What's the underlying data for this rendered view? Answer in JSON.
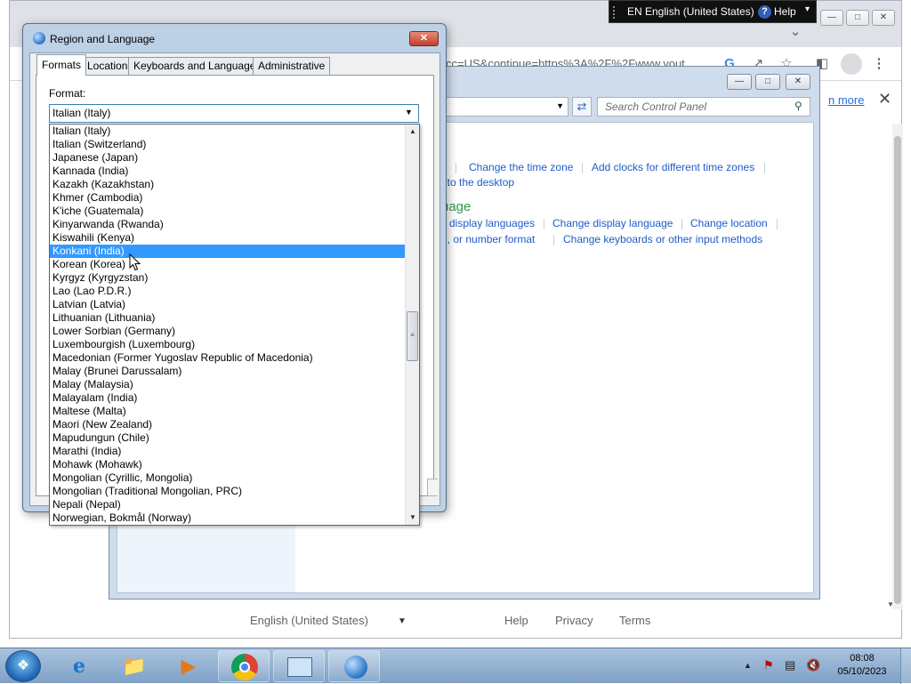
{
  "language_bar": {
    "text": "EN English (United States)",
    "help_label": "Help"
  },
  "chrome": {
    "url_fragment": "cc=US&continue=https%3A%2F%2Fwww.yout",
    "infobar_link": "n more",
    "footer": {
      "language": "English (United States)",
      "links": [
        "Help",
        "Privacy",
        "Terms"
      ]
    }
  },
  "control_panel": {
    "search_placeholder": "Search Control Panel",
    "links_row1": [
      "e",
      "Change the time zone",
      "Add clocks for different time zones"
    ],
    "link_row2": "t to the desktop",
    "heading": "uage",
    "links_row3": [
      "display languages",
      "Change display language",
      "Change location"
    ],
    "links_row4": [
      "e, or number format",
      "Change keyboards or other input methods"
    ]
  },
  "dialog": {
    "title": "Region and Language",
    "tabs": [
      "Formats",
      "Location",
      "Keyboards and Languages",
      "Administrative"
    ],
    "active_tab": "Formats",
    "format_label": "Format:",
    "selected_format": "Italian (Italy)",
    "options": [
      "Italian (Italy)",
      "Italian (Switzerland)",
      "Japanese (Japan)",
      "Kannada (India)",
      "Kazakh (Kazakhstan)",
      "Khmer (Cambodia)",
      "K'iche (Guatemala)",
      "Kinyarwanda (Rwanda)",
      "Kiswahili (Kenya)",
      "Konkani (India)",
      "Korean (Korea)",
      "Kyrgyz (Kyrgyzstan)",
      "Lao (Lao P.D.R.)",
      "Latvian (Latvia)",
      "Lithuanian (Lithuania)",
      "Lower Sorbian (Germany)",
      "Luxembourgish (Luxembourg)",
      "Macedonian (Former Yugoslav Republic of Macedonia)",
      "Malay (Brunei Darussalam)",
      "Malay (Malaysia)",
      "Malayalam (India)",
      "Maltese (Malta)",
      "Maori (New Zealand)",
      "Mapudungun (Chile)",
      "Marathi (India)",
      "Mohawk (Mohawk)",
      "Mongolian (Cyrillic, Mongolia)",
      "Mongolian (Traditional Mongolian, PRC)",
      "Nepali (Nepal)",
      "Norwegian, Bokmål (Norway)"
    ],
    "highlighted_option": "Konkani (India)"
  },
  "taskbar": {
    "apps": [
      "start-orb",
      "internet-explorer",
      "windows-explorer",
      "media-player",
      "chrome",
      "control-panel",
      "region-globe"
    ],
    "clock_time": "08:08",
    "clock_date": "05/10/2023"
  },
  "colors": {
    "selection": "#3399ff",
    "link": "#1e5cc9",
    "heading_green": "#2d9a49"
  }
}
